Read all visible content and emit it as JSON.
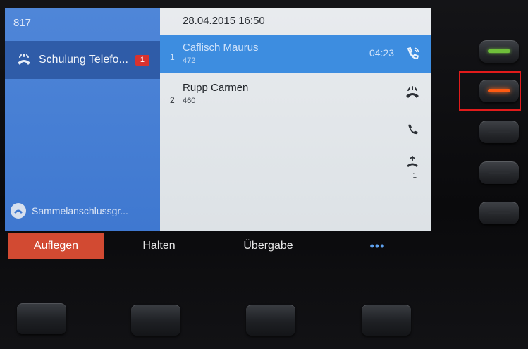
{
  "left_pane": {
    "line_number": "817",
    "line_label": "Schulung Telefo...",
    "line_badge": "1",
    "hunt_group_label": "Sammelanschlussgr..."
  },
  "right_pane": {
    "datetime": "28.04.2015 16:50",
    "calls": [
      {
        "index": "1",
        "name": "Caflisch Maurus",
        "number": "472",
        "timer": "04:23",
        "state": "active"
      },
      {
        "index": "2",
        "name": "Rupp Carmen",
        "number": "460",
        "state": "held"
      }
    ],
    "side_icons": [
      "handset-icon",
      "callback-icon"
    ],
    "side_sub_label": "1"
  },
  "softkeys": {
    "hangup": "Auflegen",
    "hold": "Halten",
    "transfer": "Übergabe",
    "more": "•••"
  },
  "hardware": {
    "line_keys": [
      {
        "led": "green"
      },
      {
        "led": "orange"
      },
      {
        "led": "off"
      },
      {
        "led": "off"
      },
      {
        "led": "off"
      }
    ],
    "highlight_color": "#e11b1b",
    "accent_blue": "#3d8de0",
    "hangup_red": "#d24a32"
  }
}
